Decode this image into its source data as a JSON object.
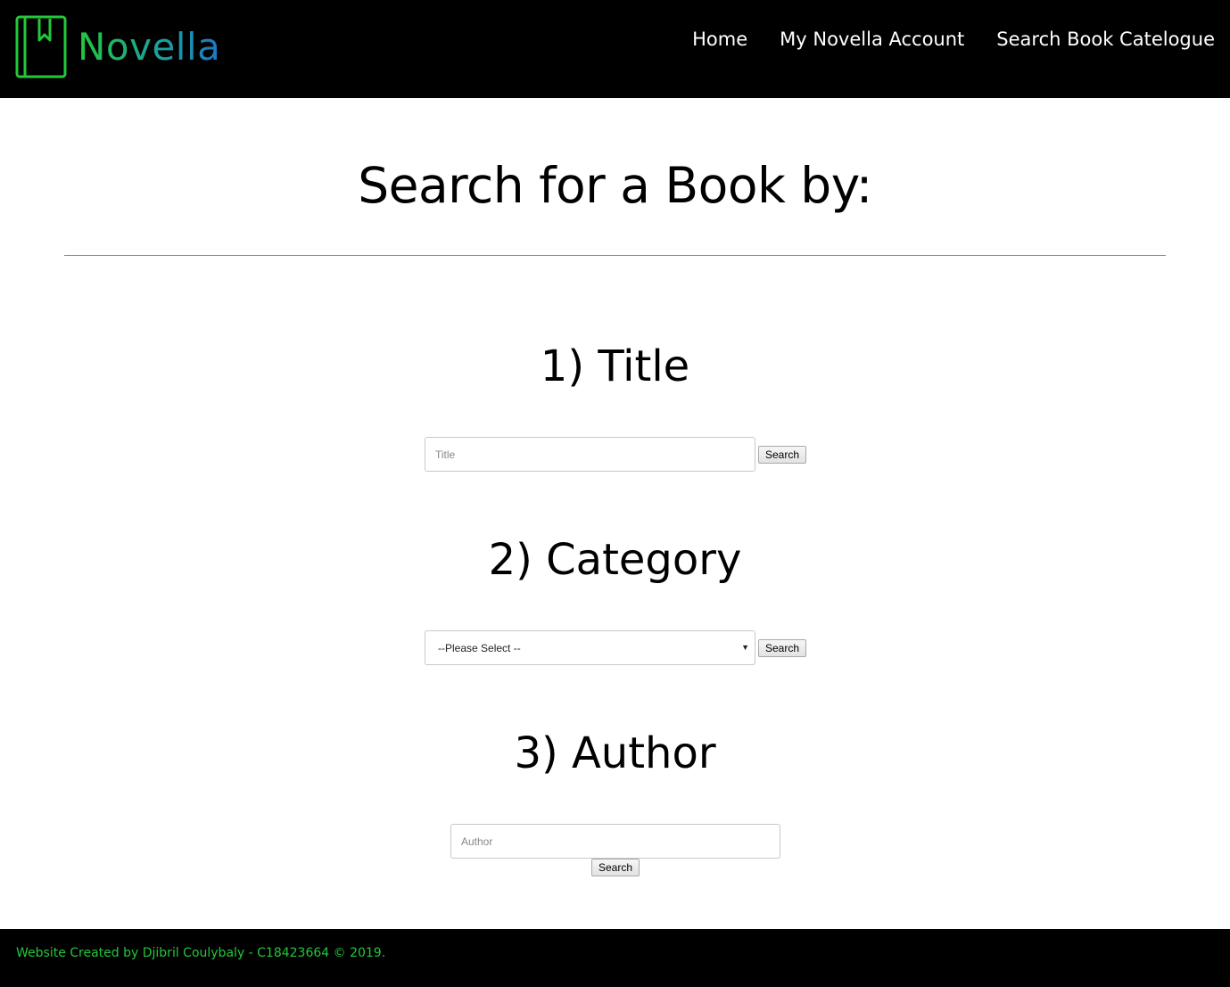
{
  "header": {
    "logo_text": "Novella",
    "nav": [
      {
        "label": "Home"
      },
      {
        "label": "My Novella Account"
      },
      {
        "label": "Search Book Catelogue"
      }
    ]
  },
  "main": {
    "page_title": "Search for a Book by:",
    "sections": [
      {
        "heading": "1) Title",
        "input_placeholder": "Title",
        "button_label": "Search"
      },
      {
        "heading": "2) Category",
        "select_value": "--Please Select --",
        "button_label": "Search"
      },
      {
        "heading": "3) Author",
        "input_placeholder": "Author",
        "button_label": "Search"
      }
    ]
  },
  "footer": {
    "text": "Website Created by Djibril Coulybaly - C18423664 © 2019."
  },
  "colors": {
    "header_bg": "#000000",
    "brand_green": "#22c83a",
    "brand_blue": "#1a78c8",
    "footer_text": "#22c83a"
  },
  "icons": {
    "logo": "bookmark-book-icon",
    "select_arrow": "caret-down-icon"
  }
}
